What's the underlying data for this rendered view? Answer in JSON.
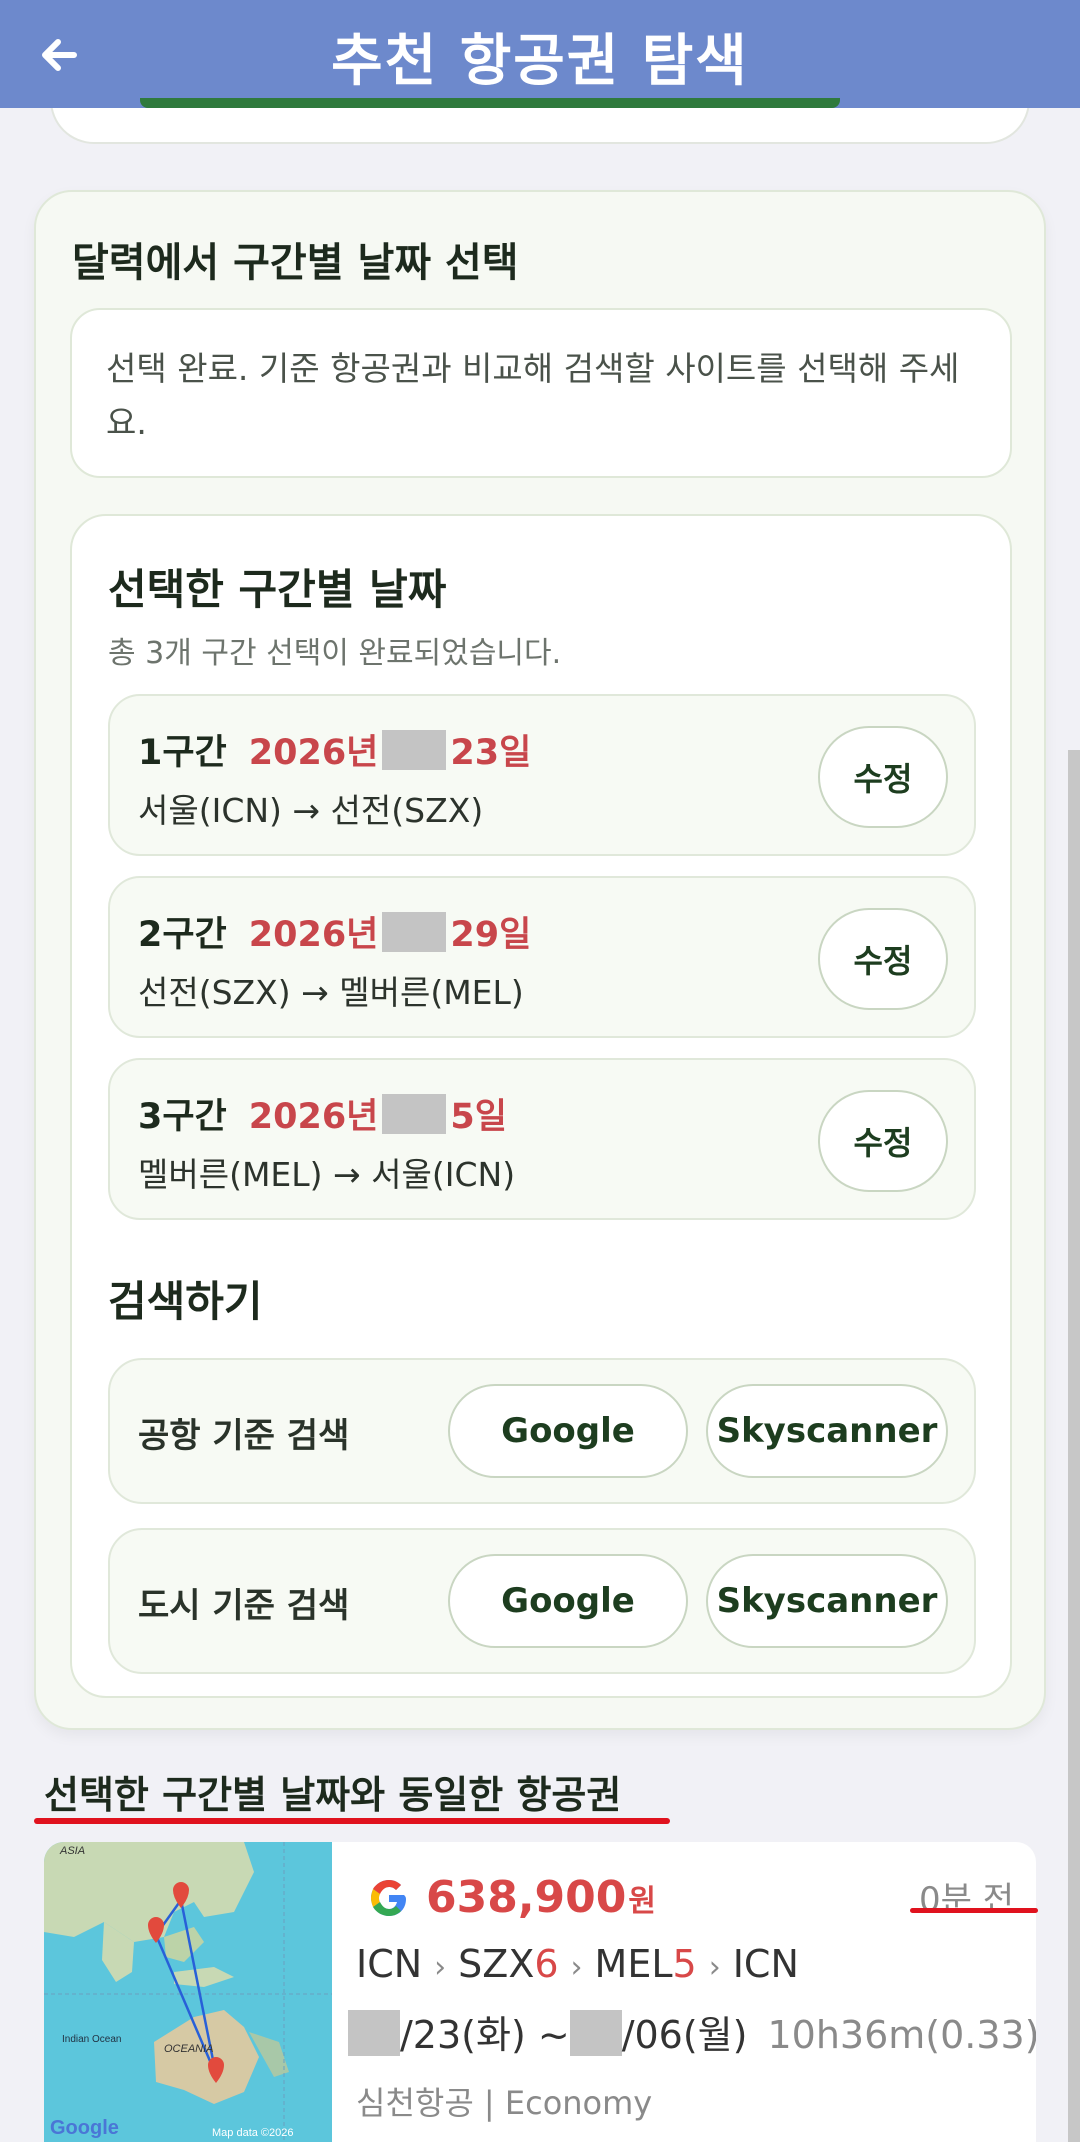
{
  "header": {
    "title": "추천 항공권 탐색"
  },
  "calendar_section": {
    "title": "달력에서 구간별 날짜 선택",
    "message": "선택 완료. 기준 항공권과 비교해 검색할 사이트를 선택해 주세요."
  },
  "selected_dates": {
    "title": "선택한 구간별 날짜",
    "subtitle": "총 3개 구간 선택이 완료되었습니다.",
    "segments": [
      {
        "label": "1구간",
        "year": "2026년",
        "day": "23일",
        "route": "서울(ICN) → 선전(SZX)",
        "edit_label": "수정"
      },
      {
        "label": "2구간",
        "year": "2026년",
        "day": "29일",
        "route": "선전(SZX) → 멜버른(MEL)",
        "edit_label": "수정"
      },
      {
        "label": "3구간",
        "year": "2026년",
        "day": "5일",
        "route": "멜버른(MEL) → 서울(ICN)",
        "edit_label": "수정"
      }
    ]
  },
  "search": {
    "title": "검색하기",
    "rows": [
      {
        "label": "공항 기준 검색",
        "google": "Google",
        "skyscanner": "Skyscanner"
      },
      {
        "label": "도시 기준 검색",
        "google": "Google",
        "skyscanner": "Skyscanner"
      }
    ]
  },
  "same_tickets": {
    "title": "선택한 구간별 날짜와 동일한 항공권",
    "result": {
      "price": "638,900",
      "currency": "원",
      "ago": "0분 전",
      "route": {
        "a": "ICN",
        "b": "SZX",
        "b_days": "6",
        "c": "MEL",
        "c_days": "5",
        "d": "ICN"
      },
      "date_start": "/23(화) ~",
      "date_end": "/06(월)",
      "duration": "10h36m(0.33)",
      "airline": "심천항공 | Economy",
      "map_labels": {
        "asia": "ASIA",
        "indian_ocean": "Indian Ocean",
        "oceania": "OCEANIA",
        "logo": "Google",
        "map_data": "Map data ©2026"
      }
    }
  },
  "colors": {
    "header": "#6d89cc",
    "accent_red": "#c8464b",
    "green_text": "#1d3d1f"
  }
}
